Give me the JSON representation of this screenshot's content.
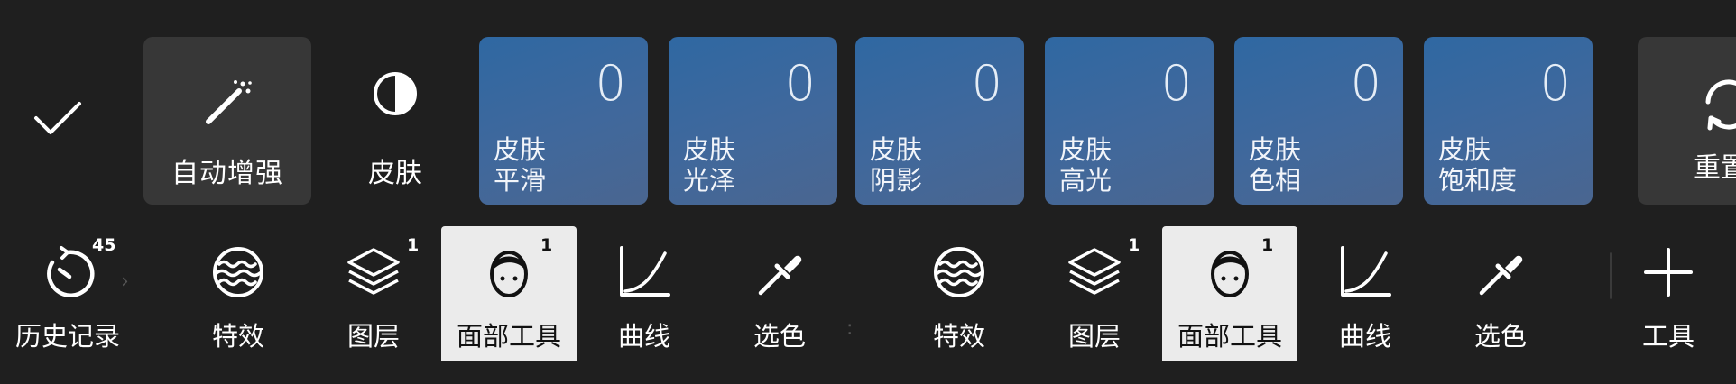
{
  "top_row": {
    "auto_enhance_label": "自动增强",
    "skin_label": "皮肤",
    "sliders": [
      {
        "value": "0",
        "line1": "皮肤",
        "line2": "平滑"
      },
      {
        "value": "0",
        "line1": "皮肤",
        "line2": "光泽"
      },
      {
        "value": "0",
        "line1": "皮肤",
        "line2": "阴影"
      },
      {
        "value": "0",
        "line1": "皮肤",
        "line2": "高光"
      },
      {
        "value": "0",
        "line1": "皮肤",
        "line2": "色相"
      },
      {
        "value": "0",
        "line1": "皮肤",
        "line2": "饱和度"
      }
    ],
    "reset_label": "重置"
  },
  "toolbar": {
    "history": {
      "label": "历史记录",
      "badge": "45"
    },
    "tools_a": [
      {
        "label": "特效",
        "badge": ""
      },
      {
        "label": "图层",
        "badge": "1"
      },
      {
        "label": "面部工具",
        "badge": "1"
      },
      {
        "label": "曲线",
        "badge": ""
      },
      {
        "label": "选色",
        "badge": ""
      }
    ],
    "tools_b": [
      {
        "label": "特效",
        "badge": ""
      },
      {
        "label": "图层",
        "badge": "1"
      },
      {
        "label": "面部工具",
        "badge": "1"
      },
      {
        "label": "曲线",
        "badge": ""
      },
      {
        "label": "选色",
        "badge": ""
      }
    ],
    "tools_label": "工具"
  },
  "colors": {
    "background": "#1f1f1f",
    "tile": "#373737",
    "slider_blue": "#3a6aa0",
    "active_tool_bg": "#ebebeb"
  }
}
